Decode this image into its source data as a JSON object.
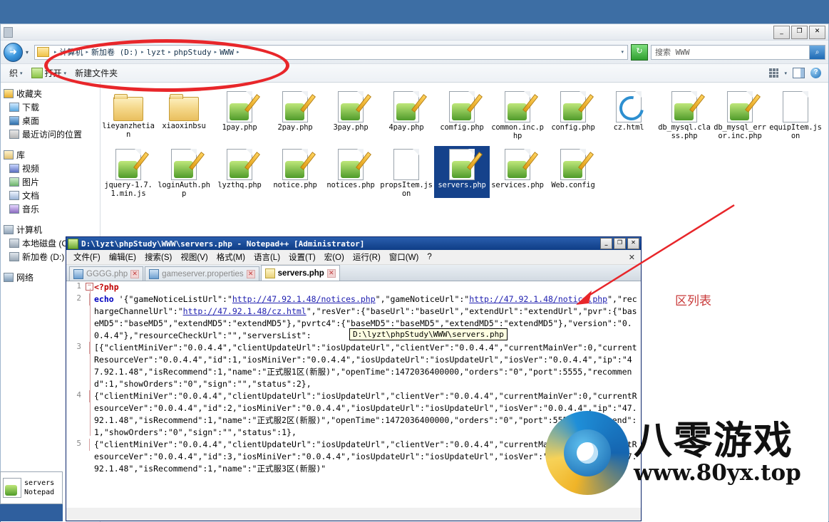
{
  "desktop": {
    "background_color": "#3d6ea4"
  },
  "explorer": {
    "window_controls": {
      "minimize": "_",
      "maximize": "❐",
      "close": "✕"
    },
    "nav": {
      "back_icon": "back-arrow-icon",
      "dropdown_caret": "▾"
    },
    "breadcrumb": {
      "folder_icon": "folder-icon",
      "parts": [
        "计算机",
        "新加卷 (D:)",
        "lyzt",
        "phpStudy",
        "WWW"
      ],
      "separator": "▸",
      "end_caret": "▾"
    },
    "refresh_label": "↻",
    "search": {
      "value": "搜索 WWW",
      "placeholder": "搜索 WWW",
      "button_icon": "search-icon"
    },
    "toolbar": {
      "organize_label": "织",
      "open_label": "打开",
      "newfolder_label": "新建文件夹",
      "caret": "▾",
      "view_icon": "view-grid-icon",
      "preview_icon": "preview-pane-icon",
      "help_icon": "help-icon"
    },
    "navpane": [
      {
        "type": "head",
        "label": "收藏夹",
        "icon": "favorites-icon"
      },
      {
        "type": "item",
        "label": "下载",
        "icon": "downloads-icon"
      },
      {
        "type": "item",
        "label": "桌面",
        "icon": "desktop-icon"
      },
      {
        "type": "item",
        "label": "最近访问的位置",
        "icon": "recent-places-icon"
      },
      {
        "type": "head",
        "label": "库",
        "icon": "library-icon"
      },
      {
        "type": "item",
        "label": "视频",
        "icon": "videos-icon"
      },
      {
        "type": "item",
        "label": "图片",
        "icon": "pictures-icon"
      },
      {
        "type": "item",
        "label": "文档",
        "icon": "documents-icon"
      },
      {
        "type": "item",
        "label": "音乐",
        "icon": "music-icon"
      },
      {
        "type": "head",
        "label": "计算机",
        "icon": "computer-icon"
      },
      {
        "type": "item",
        "label": "本地磁盘 (C:",
        "icon": "drive-icon"
      },
      {
        "type": "item",
        "label": "新加卷 (D:)",
        "icon": "drive-icon"
      },
      {
        "type": "head",
        "label": "网络",
        "icon": "network-icon"
      }
    ],
    "files": [
      {
        "name": "lieyanzhetian",
        "kind": "folder",
        "selected": false
      },
      {
        "name": "xiaoxinbsu",
        "kind": "folder",
        "selected": false
      },
      {
        "name": "1pay.php",
        "kind": "php",
        "selected": false
      },
      {
        "name": "2pay.php",
        "kind": "php",
        "selected": false
      },
      {
        "name": "3pay.php",
        "kind": "php",
        "selected": false
      },
      {
        "name": "4pay.php",
        "kind": "php",
        "selected": false
      },
      {
        "name": "comfig.php",
        "kind": "php",
        "selected": false
      },
      {
        "name": "common.inc.php",
        "kind": "php",
        "selected": false
      },
      {
        "name": "config.php",
        "kind": "php",
        "selected": false
      },
      {
        "name": "cz.html",
        "kind": "html",
        "selected": false
      },
      {
        "name": "db_mysql.class.php",
        "kind": "php",
        "selected": false
      },
      {
        "name": "db_mysql_error.inc.php",
        "kind": "php",
        "selected": false
      },
      {
        "name": "equipItem.json",
        "kind": "json",
        "selected": false
      },
      {
        "name": "jquery-1.7.1.min.js",
        "kind": "php",
        "selected": false
      },
      {
        "name": "loginAuth.php",
        "kind": "php",
        "selected": false
      },
      {
        "name": "lyzthq.php",
        "kind": "php",
        "selected": false
      },
      {
        "name": "notice.php",
        "kind": "php",
        "selected": false
      },
      {
        "name": "notices.php",
        "kind": "php",
        "selected": false
      },
      {
        "name": "propsItem.json",
        "kind": "json",
        "selected": false
      },
      {
        "name": "servers.php",
        "kind": "php",
        "selected": true
      },
      {
        "name": "services.php",
        "kind": "php",
        "selected": false
      },
      {
        "name": "Web.config",
        "kind": "php",
        "selected": false
      }
    ]
  },
  "notepad": {
    "title": "D:\\lyzt\\phpStudy\\WWW\\servers.php - Notepad++ [Administrator]",
    "window_controls": {
      "minimize": "_",
      "maximize": "❐",
      "close": "✕"
    },
    "menu": [
      "文件(F)",
      "编辑(E)",
      "搜索(S)",
      "视图(V)",
      "格式(M)",
      "语言(L)",
      "设置(T)",
      "宏(O)",
      "运行(R)",
      "窗口(W)",
      "?"
    ],
    "menu_close": "✕",
    "tabs": [
      {
        "label": "GGGG.php",
        "active": false,
        "close": "✕"
      },
      {
        "label": "gameserver.properties",
        "active": false,
        "close": "✕"
      },
      {
        "label": "servers.php",
        "active": true,
        "close": "✕"
      }
    ],
    "tooltip_path": "D:\\lyzt\\phpStudy\\WWW\\servers.php",
    "code_lines": [
      {
        "number": "1",
        "fold": "-",
        "text": "<?php",
        "style": "phptag"
      },
      {
        "number": "2",
        "fold": "",
        "text": "echo '{\"gameNoticeListUrl\":\"http://47.92.1.48/notices.php\",\"gameNoticeUrl\":\"http://47.92.1.48/notice.php\",\"rechargeChannelUrl\":\"http://47.92.1.48/cz.html\",\"resVer\":{\"baseUrl\":\"baseUrl\",\"extendUrl\":\"extendUrl\",\"pvr\":{\"baseMD5\":\"baseMD5\",\"extendMD5\":\"extendMD5\"},\"pvrtc4\":{\"baseMD5\":\"baseMD5\",\"extendMD5\":\"extendMD5\"},\"version\":\"0.0.4.4\"},\"resourceCheckUrl\":\"\",\"serversList\":",
        "style": "echo"
      },
      {
        "number": "3",
        "fold": "",
        "text": "[{\"clientMiniVer\":\"0.0.4.4\",\"clientUpdateUrl\":\"iosUpdateUrl\",\"clientVer\":\"0.0.4.4\",\"currentMainVer\":0,\"currentResourceVer\":\"0.0.4.4\",\"id\":1,\"iosMiniVer\":\"0.0.4.4\",\"iosUpdateUrl\":\"iosUpdateUrl\",\"iosVer\":\"0.0.4.4\",\"ip\":\"47.92.1.48\",\"isRecommend\":1,\"name\":\"正式服1区(新服)\",\"openTime\":1472036400000,\"orders\":\"0\",\"port\":5555,\"recommend\":1,\"showOrders\":\"0\",\"sign\":\"\",\"status\":2},",
        "style": "plain"
      },
      {
        "number": "4",
        "fold": "",
        "text": "{\"clientMiniVer\":\"0.0.4.4\",\"clientUpdateUrl\":\"iosUpdateUrl\",\"clientVer\":\"0.0.4.4\",\"currentMainVer\":0,\"currentResourceVer\":\"0.0.4.4\",\"id\":2,\"iosMiniVer\":\"0.0.4.4\",\"iosUpdateUrl\":\"iosUpdateUrl\",\"iosVer\":\"0.0.4.4\",\"ip\":\"47.92.1.48\",\"isRecommend\":1,\"name\":\"正式服2区(新服)\",\"openTime\":1472036400000,\"orders\":\"0\",\"port\":5556,\"recommend\":1,\"showOrders\":\"0\",\"sign\":\"\",\"status\":1},",
        "style": "plain"
      },
      {
        "number": "5",
        "fold": "",
        "text": "{\"clientMiniVer\":\"0.0.4.4\",\"clientUpdateUrl\":\"iosUpdateUrl\",\"clientVer\":\"0.0.4.4\",\"currentMainVer\":0,\"currentResourceVer\":\"0.0.4.4\",\"id\":3,\"iosMiniVer\":\"0.0.4.4\",\"iosUpdateUrl\":\"iosUpdateUrl\",\"iosVer\":\"0.0.4.4\",\"ip\":\"47.92.1.48\",\"isRecommend\":1,\"name\":\"正式服3区(新服)\"",
        "style": "plain"
      }
    ]
  },
  "annotations": {
    "ellipse_target": "address-bar",
    "red_label": "区列表",
    "arrow_color": "#e8262a",
    "ellipse_color": "#e8262a"
  },
  "watermark": {
    "cn_text": "八零游戏",
    "url_text": "www.80yx.top"
  },
  "taskbar_thumb": {
    "line1": "servers",
    "line2": "Notepad"
  }
}
